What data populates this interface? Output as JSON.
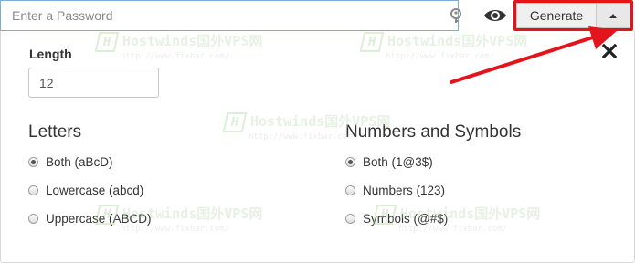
{
  "topbar": {
    "password_placeholder": "Enter a Password",
    "password_value": "",
    "key_icon": "key-icon",
    "eye_icon": "eye-icon",
    "generate_label": "Generate",
    "caret_icon": "caret-up-icon"
  },
  "panel": {
    "close_icon": "close-x-icon",
    "length": {
      "label": "Length",
      "value": "12"
    },
    "letters": {
      "title": "Letters",
      "options": [
        {
          "label": "Both (aBcD)",
          "checked": true
        },
        {
          "label": "Lowercase (abcd)",
          "checked": false
        },
        {
          "label": "Uppercase (ABCD)",
          "checked": false
        }
      ]
    },
    "numbers_symbols": {
      "title": "Numbers and Symbols",
      "options": [
        {
          "label": "Both (1@3$)",
          "checked": true
        },
        {
          "label": "Numbers (123)",
          "checked": false
        },
        {
          "label": "Symbols (@#$)",
          "checked": false
        }
      ]
    }
  },
  "annotation": {
    "highlight_color": "#e3141b",
    "arrow_color": "#e3141b"
  },
  "watermark": {
    "brand": "Hostwinds国外VPS网",
    "url": "http://www.fixbar.com/"
  }
}
